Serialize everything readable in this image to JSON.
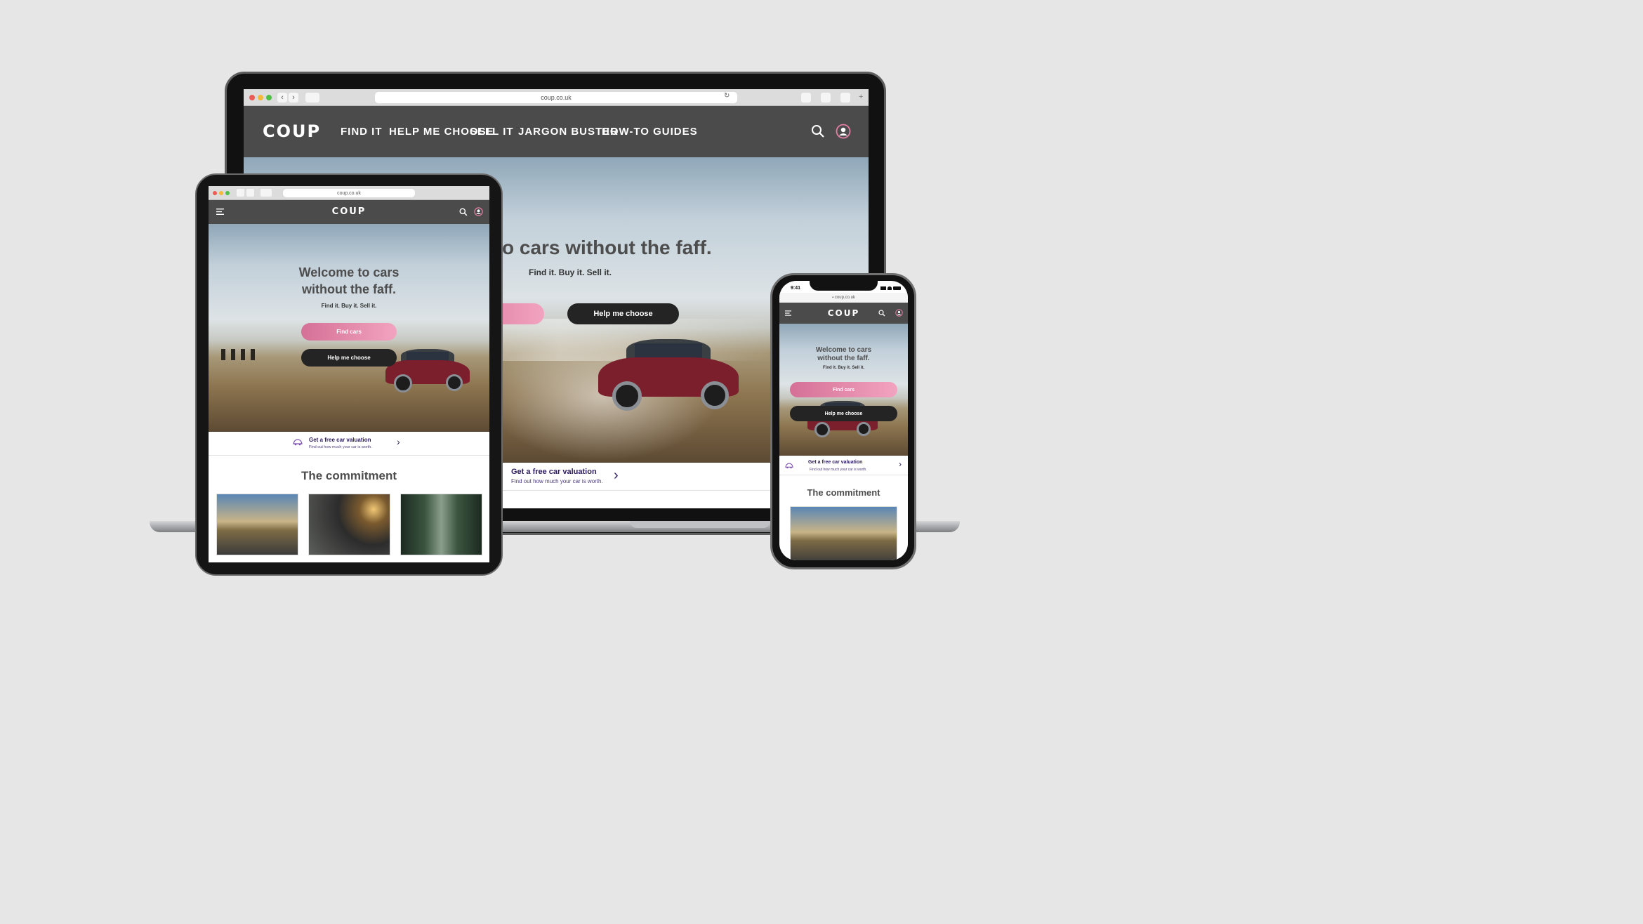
{
  "browser": {
    "url": "coup.co.uk"
  },
  "brand": {
    "logo": "COUP",
    "accent": "#d57096",
    "dark": "#242424",
    "nav_bg": "#4b4b4b",
    "valuation_color": "#2b1a5c"
  },
  "nav": {
    "items": [
      "FIND IT",
      "HELP ME CHOOSE",
      "SELL IT",
      "JARGON BUSTER",
      "HOW-TO GUIDES"
    ]
  },
  "hero": {
    "title": "Welcome to cars without the faff.",
    "title_partial": "o cars without the faff.",
    "title_line1": "Welcome to cars",
    "title_line2": "without the faff.",
    "subtitle": "Find it. Buy it. Sell it.",
    "find_cars": "Find cars",
    "help_choose": "Help me choose"
  },
  "valuation": {
    "title": "Get a free car valuation",
    "subtitle": "Find out how much your car is worth."
  },
  "commitment": {
    "title": "The commitment"
  },
  "phone": {
    "time": "9:41",
    "url": "coup.co.uk"
  },
  "icons": [
    "search-icon",
    "user-account-icon",
    "menu-icon",
    "car-outline-icon",
    "chevron-right-icon",
    "lock-icon",
    "reload-icon",
    "share-icon",
    "tabs-icon",
    "sidebar-icon",
    "back-icon",
    "forward-icon",
    "signal-icon",
    "wifi-icon",
    "battery-icon"
  ]
}
